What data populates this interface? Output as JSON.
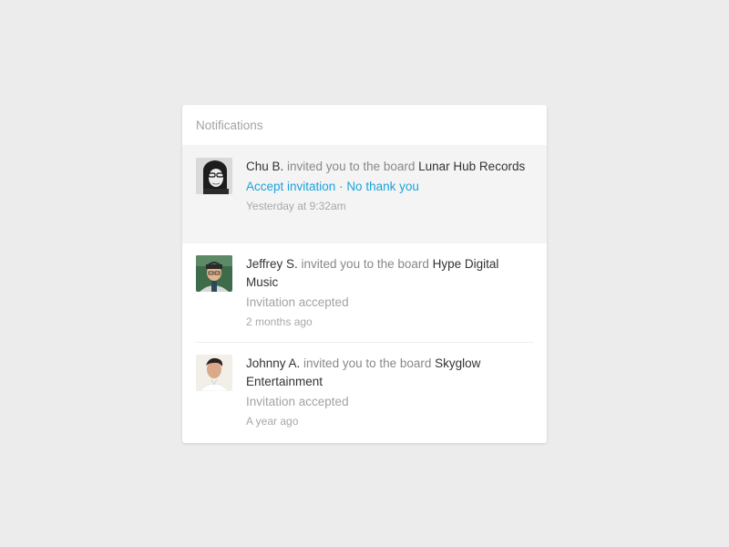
{
  "header": {
    "title": "Notifications"
  },
  "colors": {
    "background": "#ececec",
    "panel": "#ffffff",
    "highlight": "#f4f4f4",
    "link": "#1aa3dd",
    "text_strong": "#333333",
    "text_muted": "#888888"
  },
  "notifications": [
    {
      "user": "Chu B.",
      "verb": " invited you to the board ",
      "board": "Lunar Hub Records",
      "accept_label": "Accept invitation",
      "separator": " · ",
      "decline_label": "No thank you",
      "time": "Yesterday at 9:32am",
      "avatar_icon": "avatar-woman-glasses"
    },
    {
      "user": "Jeffrey S.",
      "verb": " invited you to the board ",
      "board": "Hype Digital Music",
      "status": "Invitation accepted",
      "time": "2 months ago",
      "avatar_icon": "avatar-man-cap"
    },
    {
      "user": "Johnny A.",
      "verb": " invited you to the board ",
      "board": "Skyglow Entertainment",
      "status": "Invitation accepted",
      "time": "A year ago",
      "avatar_icon": "avatar-man-white-shirt"
    }
  ]
}
